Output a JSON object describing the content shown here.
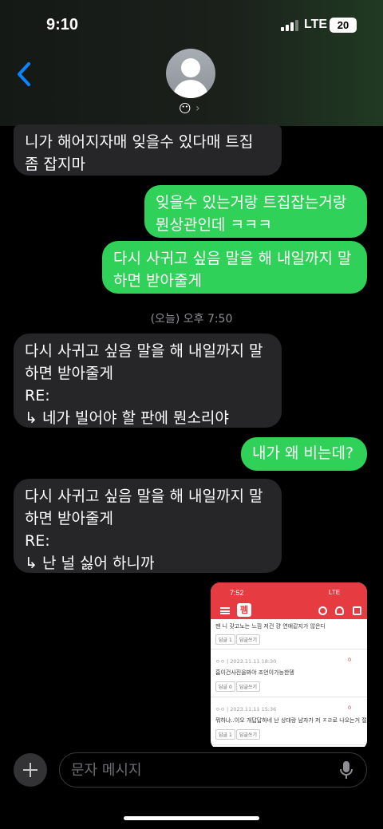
{
  "status_bar": {
    "time": "9:10",
    "network": "LTE",
    "battery": "20"
  },
  "header": {
    "contact_emoji": "😶",
    "chevron": "›",
    "back_icon": "chevron-left-icon"
  },
  "messages": [
    {
      "direction": "in",
      "text": "니가 해어지자매  잊을수 있다매 트집\n좀 잡지마"
    },
    {
      "direction": "out",
      "text": "잊을수 있는거랑 트집잡는거랑\n뭔상관인데 ㅋㅋㅋ"
    },
    {
      "direction": "out",
      "text": "다시 사귀고 싶음 말을 해 내일까지 말\n하면 받아줄게"
    },
    {
      "direction": "in",
      "text": "다시 사귀고 싶음 말을 해 내일까지 말\n하면 받아줄게\nRE:\n↳ 네가 빌어야 할 판에 뭔소리야"
    },
    {
      "direction": "out",
      "text": "내가 왜 비는데?"
    },
    {
      "direction": "in",
      "text": "다시 사귀고 싶음 말을 해 내일까지 말\n하면 받아줄게\nRE:\n↳ 난 널 싫어 하니까"
    }
  ],
  "timestamp": "(오늘) 오후 7:50",
  "attachment": {
    "time": "7:52",
    "network": "LTE",
    "logo": "펨",
    "rows": [
      {
        "text": "잰 니 갖고노는 느낌 저건 걍 연애같지가 않은디",
        "reply": "답글 1",
        "write": "답글쓰기"
      },
      {
        "meta": "ㅇㅇ  |  2023.11.11 18:30",
        "text": "흠이건사진을봐야 조언이가능한뎅",
        "reply": "답글 0",
        "write": "답글쓰기",
        "likes": "0"
      },
      {
        "meta": "ㅇㅇ  |  2023.11.11 15:36",
        "text": "뭐하냐..이오 개답답하네 난 상대랑 남자가 저 ㅈㄹ로 나오는거 절대못봄",
        "reply": "답글 1",
        "write": "답글쓰기",
        "likes": "0"
      }
    ]
  },
  "compose": {
    "placeholder": "문자 메시지"
  },
  "colors": {
    "incoming": "#262628",
    "outgoing": "#30d158",
    "attachment_accent": "#e63c41"
  }
}
